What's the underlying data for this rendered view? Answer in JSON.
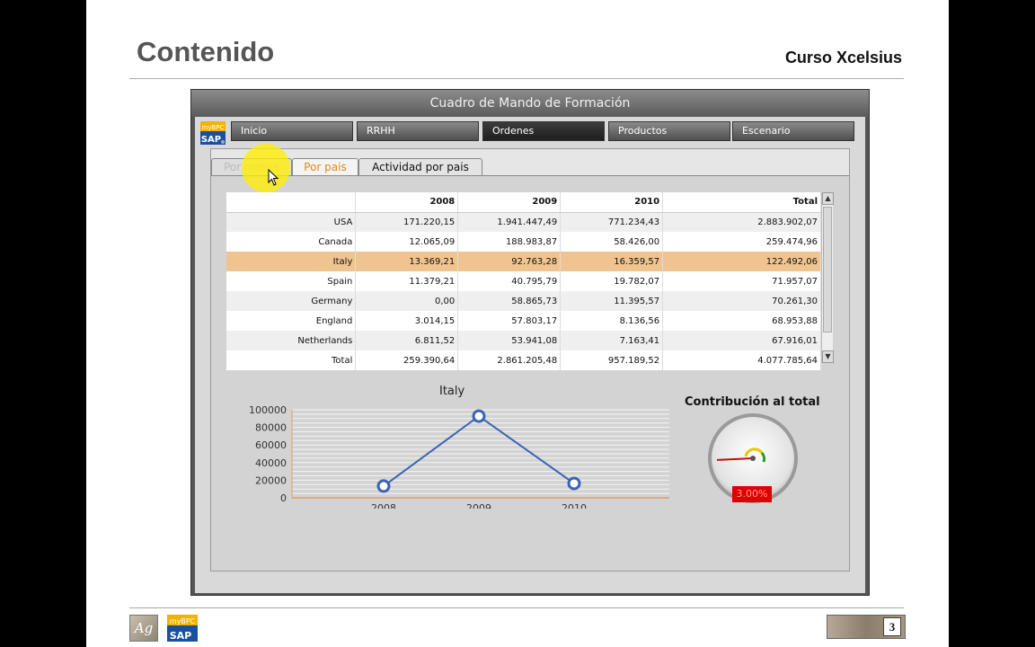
{
  "slide": {
    "title": "Contenido",
    "course": "Curso Xcelsius",
    "page_number": "3",
    "footer_logo_ag": "Ag"
  },
  "dashboard": {
    "title": "Cuadro de Mando de Formación",
    "logo_top": "myBPC",
    "logo_bottom": "SAP",
    "nav": [
      {
        "label": "Inicio"
      },
      {
        "label": "RRHH"
      },
      {
        "label": "Ordenes",
        "active": true
      },
      {
        "label": "Productos"
      },
      {
        "label": "Escenario"
      }
    ],
    "tabs": [
      {
        "label": "Por meses"
      },
      {
        "label": "Por pais",
        "active": true
      },
      {
        "label": "Actividad por pais"
      }
    ],
    "table": {
      "headers": [
        "",
        "2008",
        "2009",
        "2010",
        "Total"
      ],
      "rows": [
        [
          "USA",
          "171.220,15",
          "1.941.447,49",
          "771.234,43",
          "2.883.902,07"
        ],
        [
          "Canada",
          "12.065,09",
          "188.983,87",
          "58.426,00",
          "259.474,96"
        ],
        [
          "Italy",
          "13.369,21",
          "92.763,28",
          "16.359,57",
          "122.492,06"
        ],
        [
          "Spain",
          "11.379,21",
          "40.795,79",
          "19.782,07",
          "71.957,07"
        ],
        [
          "Germany",
          "0,00",
          "58.865,73",
          "11.395,57",
          "70.261,30"
        ],
        [
          "England",
          "3.014,15",
          "57.803,17",
          "8.136,56",
          "68.953,88"
        ],
        [
          "Netherlands",
          "6.811,52",
          "53.941,08",
          "7.163,41",
          "67.916,01"
        ],
        [
          "Total",
          "259.390,64",
          "2.861.205,48",
          "957.189,52",
          "4.077.785,64"
        ]
      ],
      "selected_row": 2
    },
    "gauge": {
      "title": "Contribución al total",
      "value_label": "3.00%",
      "value": 0.03
    }
  },
  "chart_data": {
    "type": "line",
    "title": "Italy",
    "categories": [
      "2008",
      "2009",
      "2010"
    ],
    "series": [
      {
        "values": [
          13369.21,
          92763.28,
          16359.57
        ]
      }
    ],
    "ylim": [
      0,
      100000
    ],
    "yticks": [
      "0",
      "20000",
      "40000",
      "60000",
      "80000",
      "100000"
    ],
    "grid": true,
    "colors": {
      "line": "#3a64b4",
      "axis": "#e0a060"
    }
  }
}
